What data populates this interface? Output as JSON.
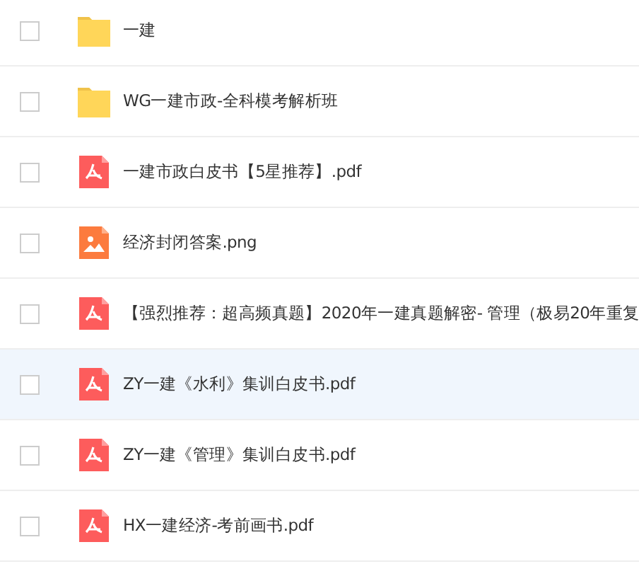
{
  "files": [
    {
      "kind": "folder",
      "name": "一建",
      "selected": false,
      "checked": false
    },
    {
      "kind": "folder",
      "name": "WG一建市政-全科模考解析班",
      "selected": false,
      "checked": false
    },
    {
      "kind": "pdf",
      "name": "一建市政白皮书【5星推荐】.pdf",
      "selected": false,
      "checked": false
    },
    {
      "kind": "image",
      "name": "经济封闭答案.png",
      "selected": false,
      "checked": false
    },
    {
      "kind": "pdf",
      "name": "【强烈推荐：超高频真题】2020年一建真题解密- 管理（极易20年重复",
      "selected": false,
      "checked": false
    },
    {
      "kind": "pdf",
      "name": "ZY一建《水利》集训白皮书.pdf",
      "selected": true,
      "checked": false
    },
    {
      "kind": "pdf",
      "name": "ZY一建《管理》集训白皮书.pdf",
      "selected": false,
      "checked": false
    },
    {
      "kind": "pdf",
      "name": "HX一建经济-考前画书.pdf",
      "selected": false,
      "checked": false
    }
  ]
}
